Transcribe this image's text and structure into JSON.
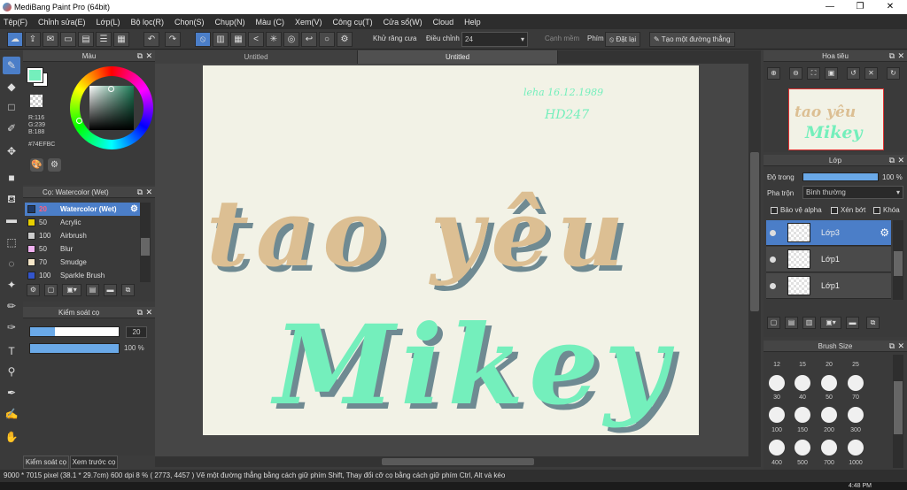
{
  "window": {
    "title": "MediBang Paint Pro (64bit)",
    "minimize": "—",
    "maximize": "❐",
    "close": "✕"
  },
  "menu": [
    "Tệp(F)",
    "Chỉnh sửa(E)",
    "Lớp(L)",
    "Bộ lọc(R)",
    "Chọn(S)",
    "Chụp(N)",
    "Màu (C)",
    "Xem(V)",
    "Công cụ(T)",
    "Cửa sổ(W)",
    "Cloud",
    "Help"
  ],
  "toolbar": {
    "antialias_label": "Khử răng cưa",
    "adjust_label": "Điều chỉnh",
    "adjust_value": "24",
    "edge_label": "Cạnh mềm",
    "key_label": "Phím",
    "reset_label": "Đặt lại",
    "line_label": "Tạo một đường thẳng"
  },
  "tabs": [
    "Untitled",
    "Untitled"
  ],
  "color_panel": {
    "title": "Màu",
    "r": "R:116",
    "g": "G:239",
    "b": "B:188",
    "hex": "#74EFBC",
    "primary_color": "#74EFBC",
    "secondary_color": "#ffffff"
  },
  "brush_panel": {
    "title": "Cọ: Watercolor (Wet)",
    "brushes": [
      {
        "size": "20",
        "name": "Watercolor (Wet)",
        "color": "#1f3a66",
        "selected": true
      },
      {
        "size": "50",
        "name": "Acrylic",
        "color": "#e8d000",
        "selected": false
      },
      {
        "size": "100",
        "name": "Airbrush",
        "color": "#cccccc",
        "selected": false
      },
      {
        "size": "50",
        "name": "Blur",
        "color": "#f0b0f0",
        "selected": false
      },
      {
        "size": "70",
        "name": "Smudge",
        "color": "#f5e6c8",
        "selected": false
      },
      {
        "size": "100",
        "name": "Sparkle Brush",
        "color": "#3355cc",
        "selected": false
      }
    ]
  },
  "brush_control": {
    "title": "Kiểm soát cọ",
    "size_value": "20",
    "opacity_value": "100 %",
    "size_fraction": 0.28,
    "opacity_fraction": 1.0
  },
  "left_tabs": [
    "Kiểm soát cọ",
    "Xem trước cọ"
  ],
  "canvas_text": {
    "signature_line1": "leha 16.12.1989",
    "signature_line2": "HD247",
    "word1": "tao yêu",
    "word2": "Mikey"
  },
  "navigator": {
    "title": "Hoa tiêu",
    "preview_line1": "tao yêu",
    "preview_line2": "Mikey"
  },
  "layer_panel": {
    "title": "Lớp",
    "opacity_label": "Độ trong",
    "opacity_value": "100 %",
    "blend_label": "Pha trộn",
    "blend_value": "Bình thường",
    "protect_alpha": "Bảo vệ alpha",
    "clip": "Xén bớt",
    "lock": "Khóa",
    "layers": [
      {
        "name": "Lớp3",
        "selected": true
      },
      {
        "name": "Lớp1",
        "selected": false
      },
      {
        "name": "Lớp1",
        "selected": false
      }
    ]
  },
  "brush_size_panel": {
    "title": "Brush Size",
    "row0": [
      "12",
      "15",
      "20",
      "25"
    ],
    "row1": [
      "30",
      "40",
      "50",
      "70"
    ],
    "row2": [
      "100",
      "150",
      "200",
      "300"
    ],
    "row3": [
      "400",
      "500",
      "700",
      "1000"
    ]
  },
  "status": {
    "text": "9000 * 7015 pixel  (38.1 * 29.7cm)  600 dpi  8 %  ( 2773, 4457 )  Vẽ một đường thẳng bằng cách giữ phím Shift, Thay đổi cỡ cọ bằng cách giữ phím Ctrl, Alt và kéo"
  },
  "taskbar": {
    "time": "4:48 PM"
  }
}
